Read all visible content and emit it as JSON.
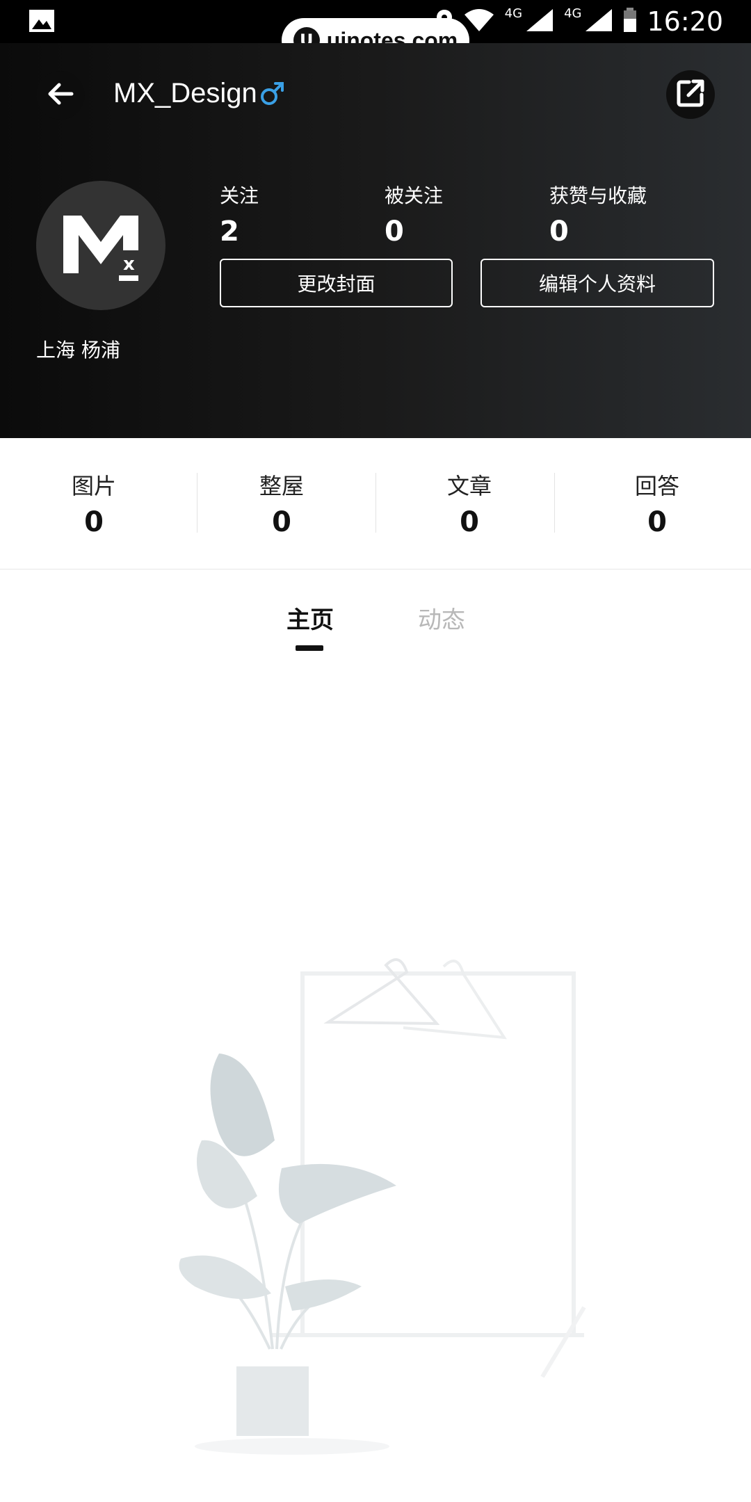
{
  "status_bar": {
    "time": "16:20",
    "network_1": "4G",
    "network_2": "4G",
    "watermark": "uinotes.com"
  },
  "header": {
    "title": "MX_Design",
    "location": "上海 杨浦",
    "stats": [
      {
        "label": "关注",
        "value": "2"
      },
      {
        "label": "被关注",
        "value": "0"
      },
      {
        "label": "获赞与收藏",
        "value": "0"
      }
    ],
    "buttons": {
      "change_cover": "更改封面",
      "edit_profile": "编辑个人资料"
    }
  },
  "counters": [
    {
      "label": "图片",
      "value": "0"
    },
    {
      "label": "整屋",
      "value": "0"
    },
    {
      "label": "文章",
      "value": "0"
    },
    {
      "label": "回答",
      "value": "0"
    }
  ],
  "tabs": [
    {
      "label": "主页",
      "active": true
    },
    {
      "label": "动态",
      "active": false
    }
  ],
  "colors": {
    "accent_gender": "#3aa0e6",
    "header_bg": "#1a1a1a",
    "tab_inactive": "#b8b8b8"
  },
  "icons": {
    "back": "arrow-left-icon",
    "gender": "male-icon",
    "share": "share-external-icon",
    "status_image": "image-icon"
  }
}
